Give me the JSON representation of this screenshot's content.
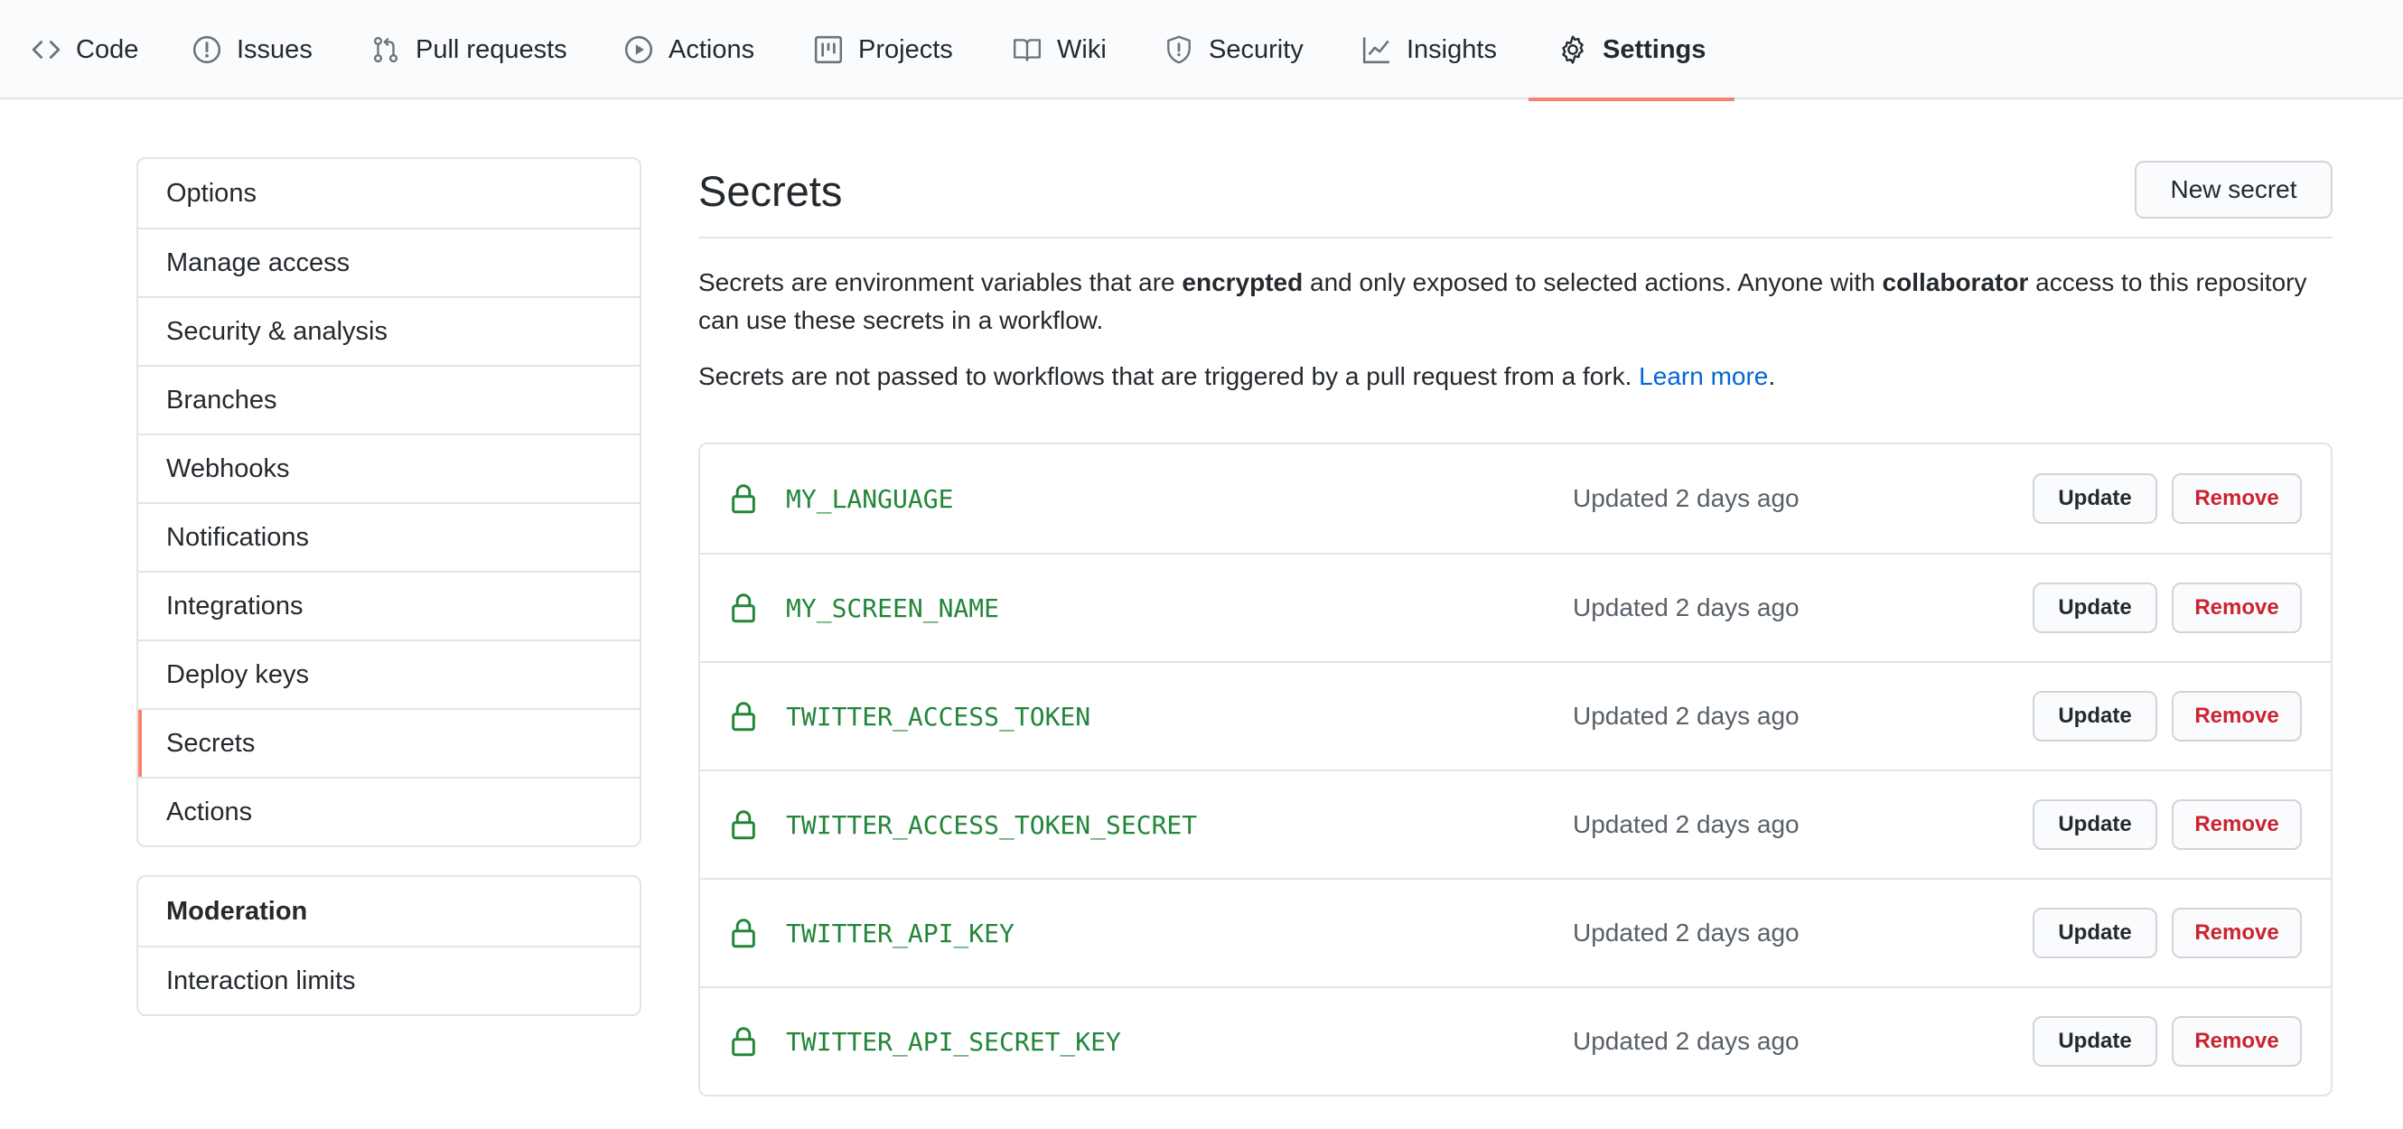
{
  "repo_nav": {
    "tabs": [
      {
        "label": "Code",
        "icon": "code-icon"
      },
      {
        "label": "Issues",
        "icon": "issue-icon"
      },
      {
        "label": "Pull requests",
        "icon": "pull-request-icon"
      },
      {
        "label": "Actions",
        "icon": "play-icon"
      },
      {
        "label": "Projects",
        "icon": "project-icon"
      },
      {
        "label": "Wiki",
        "icon": "book-icon"
      },
      {
        "label": "Security",
        "icon": "shield-icon"
      },
      {
        "label": "Insights",
        "icon": "graph-icon"
      },
      {
        "label": "Settings",
        "icon": "gear-icon",
        "selected": true
      }
    ],
    "accent_color": "#f9826c"
  },
  "sidebar": {
    "items": [
      {
        "label": "Options"
      },
      {
        "label": "Manage access"
      },
      {
        "label": "Security & analysis"
      },
      {
        "label": "Branches"
      },
      {
        "label": "Webhooks"
      },
      {
        "label": "Notifications"
      },
      {
        "label": "Integrations"
      },
      {
        "label": "Deploy keys"
      },
      {
        "label": "Secrets",
        "active": true
      },
      {
        "label": "Actions"
      }
    ],
    "moderation": {
      "heading": "Moderation",
      "items": [
        {
          "label": "Interaction limits"
        }
      ]
    }
  },
  "main": {
    "title": "Secrets",
    "new_secret_label": "New secret",
    "description": {
      "p1_a": "Secrets are environment variables that are ",
      "p1_b": "encrypted",
      "p1_c": " and only exposed to selected actions. Anyone with ",
      "p1_d": "collaborator",
      "p1_e": " access to this repository can use these secrets in a workflow.",
      "p2_a": "Secrets are not passed to workflows that are triggered by a pull request from a fork. ",
      "p2_link": "Learn more",
      "p2_end": "."
    },
    "secrets": [
      {
        "name": "MY_LANGUAGE",
        "updated": "Updated 2 days ago"
      },
      {
        "name": "MY_SCREEN_NAME",
        "updated": "Updated 2 days ago"
      },
      {
        "name": "TWITTER_ACCESS_TOKEN",
        "updated": "Updated 2 days ago"
      },
      {
        "name": "TWITTER_ACCESS_TOKEN_SECRET",
        "updated": "Updated 2 days ago"
      },
      {
        "name": "TWITTER_API_KEY",
        "updated": "Updated 2 days ago"
      },
      {
        "name": "TWITTER_API_SECRET_KEY",
        "updated": "Updated 2 days ago"
      }
    ],
    "update_label": "Update",
    "remove_label": "Remove",
    "secret_color": "#22863a",
    "remove_color": "#cb2431"
  }
}
